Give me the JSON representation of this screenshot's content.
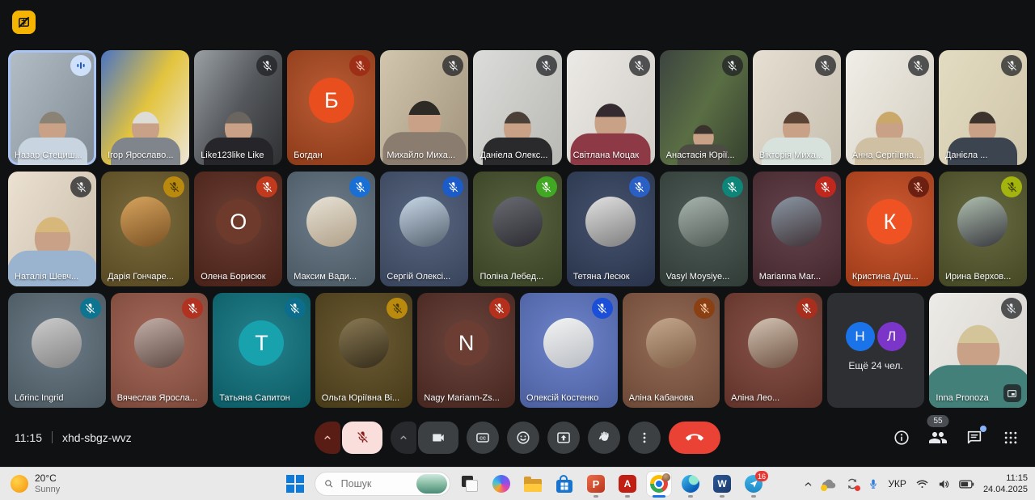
{
  "meet": {
    "time": "11:15",
    "code": "xhd-sbgz-wvz",
    "people_badge": "55",
    "cc_label": "CC",
    "colors": {
      "speaking_border": "#a9c3f2",
      "end_call": "#ea4335",
      "control_button": "#3c4043",
      "mic_muted_button": "#f9dedc"
    },
    "controls": [
      "mic-options-expand",
      "mic-off",
      "camera-options-expand",
      "camera",
      "captions",
      "reactions",
      "present-screen",
      "raise-hand",
      "more-options",
      "end-call"
    ],
    "right_icons": [
      "info",
      "people",
      "chat",
      "apps"
    ],
    "grid": {
      "rows": [
        [
          {
            "name": "Назар Стециш...",
            "kind": "video",
            "scene": [
              "#b4bec6",
              "#808a94"
            ],
            "hair": "#8a8274",
            "top": "#c8d4e0",
            "mic": {
              "state": "speaking"
            }
          },
          {
            "name": "Ігор Ярославо...",
            "kind": "video",
            "scene": [
              "#4a74c4",
              "#e3c43e",
              "#ece6da"
            ],
            "hair": "#dedcd6",
            "top": "#80858c",
            "mic": {
              "state": "none"
            }
          },
          {
            "name": "Like123like Like",
            "kind": "video",
            "scene": [
              "#9aa0a4",
              "#55585c",
              "#2e3032"
            ],
            "hair": "#6a655e",
            "top": "#26262a",
            "mic": {
              "state": "muted",
              "bg": "rgba(32,33,36,0.75)",
              "fg": "#e8eaed"
            }
          },
          {
            "name": "Богдан",
            "kind": "letter",
            "bg": "#b34a1f",
            "circle": "#e84e1e",
            "letter": "Б",
            "mic": {
              "state": "muted",
              "bg": "#9c2f16",
              "fg": "#f5c0b2"
            }
          },
          {
            "name": "Михайло Миха...",
            "kind": "video",
            "scene": [
              "#d2c6ae",
              "#a2947c"
            ],
            "hair": "#2e2a26",
            "top": "#8a7c6e",
            "mic": {
              "state": "muted",
              "bg": "rgba(32,33,36,0.75)",
              "fg": "#e8eaed"
            },
            "scale": 1.2
          },
          {
            "name": "Даніела Олекс...",
            "kind": "video",
            "scene": [
              "#dcdcda",
              "#b8b8b4"
            ],
            "hair": "#4a4038",
            "top": "#2a2a2c",
            "mic": {
              "state": "muted",
              "bg": "rgba(32,33,36,0.75)",
              "fg": "#e8eaed"
            }
          },
          {
            "name": "Світлана Моцак",
            "kind": "video",
            "scene": [
              "#eceae6",
              "#d0ccc6"
            ],
            "hair": "#342a30",
            "top": "#8e3a46",
            "mic": {
              "state": "muted",
              "bg": "rgba(32,33,36,0.75)",
              "fg": "#e8eaed"
            },
            "scale": 1.15
          },
          {
            "name": "Анастасія Юрії...",
            "kind": "video",
            "scene": [
              "#3c4440",
              "#5a6e44",
              "#35402e"
            ],
            "hair": "#3a322c",
            "top": "#4c4c44",
            "mic": {
              "state": "muted",
              "bg": "rgba(32,33,36,0.75)",
              "fg": "#e8eaed"
            },
            "scale": 0.75
          },
          {
            "name": "Вікторія Миха...",
            "kind": "video",
            "scene": [
              "#e6dfd2",
              "#c6bfb0"
            ],
            "hair": "#5a4334",
            "top": "#d8e2dc",
            "mic": {
              "state": "muted",
              "bg": "rgba(32,33,36,0.75)",
              "fg": "#e8eaed"
            }
          },
          {
            "name": "Анна Сергіївна...",
            "kind": "video",
            "scene": [
              "#f0eee8",
              "#d4cec0"
            ],
            "hair": "#c9a86a",
            "top": "#cfc0a4",
            "mic": {
              "state": "muted",
              "bg": "rgba(32,33,36,0.75)",
              "fg": "#e8eaed"
            }
          },
          {
            "name": "Данієла ...",
            "kind": "video",
            "scene": [
              "#e4dcc2",
              "#cfc6aa"
            ],
            "hair": "#3c342c",
            "top": "#3c4450",
            "mic": {
              "state": "muted",
              "bg": "rgba(32,33,36,0.75)",
              "fg": "#e8eaed"
            }
          }
        ],
        [
          {
            "name": "Наталія Шевч...",
            "kind": "video",
            "scene": [
              "#ece2d2",
              "#c8baa8"
            ],
            "hair": "#d8b87a",
            "top": "#9ab4d0",
            "mic": {
              "state": "muted",
              "bg": "rgba(32,33,36,0.75)",
              "fg": "#e8eaed"
            },
            "scale": 1.3
          },
          {
            "name": "Дарія Гончаре...",
            "kind": "avatar",
            "bg": "#6e5c2a",
            "av": [
              "#d8a45e",
              "#7a5224"
            ],
            "mic": {
              "state": "muted",
              "bg": "#ba8a0e",
              "fg": "#473a00"
            }
          },
          {
            "name": "Олена Борисюк",
            "kind": "letter",
            "bg": "#5c2a1e",
            "circle": "#6e3a2c",
            "letter": "О",
            "mic": {
              "state": "muted",
              "bg": "#c13a1d",
              "fg": "#ffffff"
            }
          },
          {
            "name": "Максим Вади...",
            "kind": "avatar",
            "bg": "#5d6f7d",
            "av": [
              "#e8e2d6",
              "#b0a088"
            ],
            "mic": {
              "state": "muted",
              "bg": "#1a6fd4",
              "fg": "#ffffff"
            }
          },
          {
            "name": "Сергій Олексі...",
            "kind": "avatar",
            "bg": "#475673",
            "av": [
              "#c9d8e8",
              "#54616e"
            ],
            "mic": {
              "state": "muted",
              "bg": "#1b5cc8",
              "fg": "#ffffff"
            }
          },
          {
            "name": "Поліна Лебед...",
            "kind": "avatar",
            "bg": "#47532d",
            "av": [
              "#6a6a72",
              "#2c2c32"
            ],
            "mic": {
              "state": "muted",
              "bg": "#41a823",
              "fg": "#ffffff"
            }
          },
          {
            "name": "Тетяна Лесюк",
            "kind": "avatar",
            "bg": "#33415f",
            "av": [
              "#e2e2e2",
              "#7e7e7e"
            ],
            "mic": {
              "state": "muted",
              "bg": "#2a5fc4",
              "fg": "#ffffff"
            }
          },
          {
            "name": "Vasyl Moysiye...",
            "kind": "avatar",
            "bg": "#3d4b45",
            "av": [
              "#a8b4ae",
              "#525c56"
            ],
            "mic": {
              "state": "muted",
              "bg": "#0d8578",
              "fg": "#ffffff"
            }
          },
          {
            "name": "Marianna Mar...",
            "kind": "avatar",
            "bg": "#553039",
            "av": [
              "#8a97a4",
              "#403236"
            ],
            "mic": {
              "state": "muted",
              "bg": "#c0281e",
              "fg": "#ffffff"
            }
          },
          {
            "name": "Кристина Душ...",
            "kind": "letter",
            "bg": "#c8491d",
            "circle": "#ef5323",
            "letter": "К",
            "mic": {
              "state": "muted",
              "bg": "#6b2012",
              "fg": "#f2b8a8"
            }
          },
          {
            "name": "Ирина Верхов...",
            "kind": "avatar",
            "bg": "#575b2d",
            "av": [
              "#b0c0b0",
              "#38383e"
            ],
            "mic": {
              "state": "muted",
              "bg": "#a3b40e",
              "fg": "#3c3c00"
            }
          }
        ],
        [
          {
            "name": "Lőrinc Ingrid",
            "kind": "avatar",
            "bg": "#5d6e7a",
            "av": [
              "#cccccc",
              "#848484"
            ],
            "mic": {
              "state": "muted",
              "bg": "#0e7490",
              "fg": "#ffffff"
            }
          },
          {
            "name": "Вячеслав Яросла...",
            "kind": "avatar",
            "bg": "#9c5a49",
            "av": [
              "#c4b0a8",
              "#5e4a42"
            ],
            "mic": {
              "state": "muted",
              "bg": "#b23222",
              "fg": "#ffffff"
            }
          },
          {
            "name": "Татьяна Сапитон",
            "kind": "letter",
            "bg": "#0d7480",
            "circle": "#17a2ae",
            "letter": "Т",
            "mic": {
              "state": "muted",
              "bg": "#0c6e8c",
              "fg": "#ffffff"
            }
          },
          {
            "name": "Ольга Юріївна Ві...",
            "kind": "avatar",
            "bg": "#5b4a1e",
            "av": [
              "#8a7a54",
              "#352c1a"
            ],
            "mic": {
              "state": "muted",
              "bg": "#ba8a0e",
              "fg": "#473a00"
            }
          },
          {
            "name": "Nagy Mariann-Zs...",
            "kind": "letter",
            "bg": "#5a3028",
            "circle": "#6b3d33",
            "letter": "N",
            "mic": {
              "state": "muted",
              "bg": "#b5301c",
              "fg": "#ffffff"
            }
          },
          {
            "name": "Олексій Костенко",
            "kind": "avatar",
            "bg": "#5f78c8",
            "av": [
              "#f4f4f4",
              "#b8bcc2"
            ],
            "mic": {
              "state": "muted",
              "bg": "#1b4fd8",
              "fg": "#ffffff"
            }
          },
          {
            "name": "Аліна Кабанова",
            "kind": "avatar",
            "bg": "#8a5c45",
            "av": [
              "#c4a88e",
              "#7e5e44"
            ],
            "mic": {
              "state": "muted",
              "bg": "#8a4012",
              "fg": "#f5c9a8"
            }
          },
          {
            "name": "Аліна Лео...",
            "kind": "avatar",
            "bg": "#7a3f34",
            "av": [
              "#d4c4b4",
              "#6e5242"
            ],
            "mic": {
              "state": "muted",
              "bg": "#a82e1e",
              "fg": "#ffffff"
            }
          },
          {
            "kind": "overflow",
            "bg": "#2d2f33",
            "label": "Ещё 24 чел.",
            "circles": [
              {
                "letter": "Н",
                "color": "#1a73e8"
              },
              {
                "letter": "Л",
                "color": "#7b35c9"
              }
            ]
          },
          {
            "name": "Inna Pronoza",
            "kind": "video",
            "scene": [
              "#edebe7",
              "#d6d3cd"
            ],
            "hair": "#d4c49a",
            "top": "#44807a",
            "mic": {
              "state": "muted",
              "bg": "rgba(32,33,36,0.75)",
              "fg": "#e8eaed"
            },
            "scale": 1.55,
            "pip": true
          }
        ]
      ]
    }
  },
  "taskbar": {
    "weather": {
      "temp": "20°C",
      "condition": "Sunny"
    },
    "search_placeholder": "Пошук",
    "apps": [
      "task-view",
      "copilot",
      "file-explorer",
      "microsoft-store",
      "powerpoint",
      "acrobat",
      "chrome",
      "edge",
      "word",
      "telegram"
    ],
    "app_letters": {
      "powerpoint": "P",
      "acrobat": "A",
      "word": "W"
    },
    "telegram_badge": "16",
    "language": "УКР",
    "clock": {
      "time": "11:15",
      "date": "24.04.2025"
    }
  }
}
